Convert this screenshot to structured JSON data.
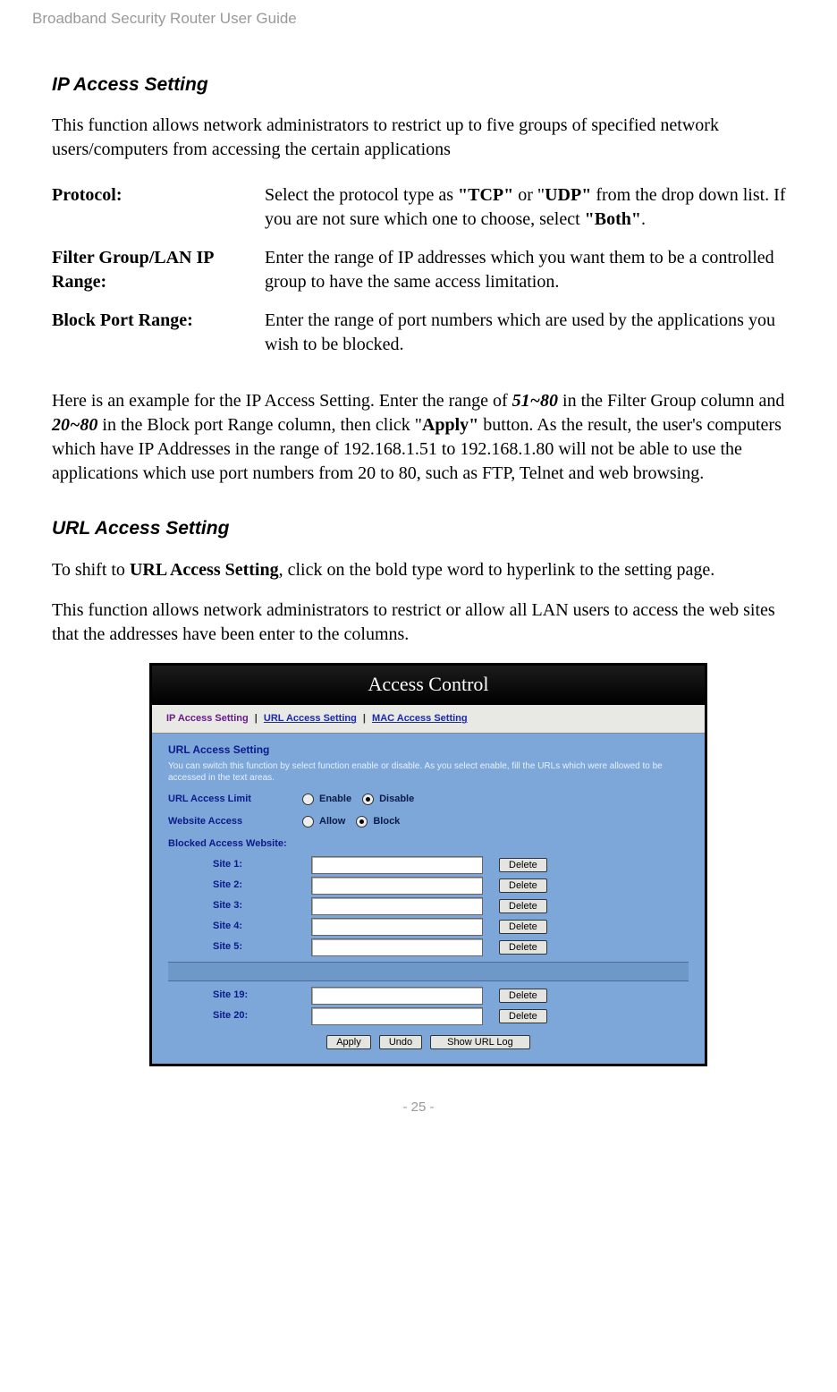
{
  "doc_header": "Broadband Security Router User Guide",
  "ip_section": {
    "heading": "IP Access Setting",
    "intro": "This function allows network administrators to restrict up to five groups of specified network users/computers from accessing the certain applications",
    "rows": [
      {
        "label": "Protocol:",
        "desc_pre": "Select the protocol type as ",
        "b1": "\"TCP\"",
        "mid1": " or \"",
        "b2": "UDP\"",
        "mid2": " from the drop down list. If you are not sure which one to choose, select ",
        "b3": "\"Both\"",
        "post": "."
      },
      {
        "label": "Filter Group/LAN IP Range:",
        "desc": "Enter the range of IP addresses which you want them to be a controlled group to have the same access limitation."
      },
      {
        "label": "Block Port Range:",
        "desc": "Enter the range of port numbers which are used by the applications you wish to be blocked."
      }
    ],
    "example_pre": "Here is an example for the IP Access Setting. Enter the range of ",
    "ex_b1": "51~80",
    "ex_mid1": " in the Filter Group column and ",
    "ex_b2": "20~80",
    "ex_mid2": " in the Block port Range column, then click \"",
    "ex_b3": "Apply\"",
    "ex_post": " button. As the result, the user's computers which have IP Addresses in the range of 192.168.1.51 to 192.168.1.80 will not be able to use the applications which use port numbers from 20 to 80, such as FTP, Telnet and web browsing."
  },
  "url_section": {
    "heading": "URL Access Setting",
    "p1_pre": "To shift to ",
    "p1_bold": "URL Access Setting",
    "p1_post": ", click on the bold type word to hyperlink to the setting page.",
    "p2": "This function allows network administrators to restrict or allow all LAN users to access the web sites that the addresses have been enter to the columns."
  },
  "ui": {
    "title": "Access Control",
    "nav": {
      "ip": "IP Access Setting",
      "url": "URL Access Setting",
      "mac": "MAC Access Setting",
      "sep": "|"
    },
    "panel_title": "URL Access Setting",
    "panel_desc": "You can switch this function by select function enable or disable. As you select enable, fill the URLs which were allowed to be accessed in the text areas.",
    "limit_label": "URL Access Limit",
    "enable": "Enable",
    "disable": "Disable",
    "access_label": "Website Access",
    "allow": "Allow",
    "block": "Block",
    "blocked_head": "Blocked Access Website:",
    "sites_top": [
      {
        "label": "Site 1:"
      },
      {
        "label": "Site 2:"
      },
      {
        "label": "Site 3:"
      },
      {
        "label": "Site 4:"
      },
      {
        "label": "Site 5:"
      }
    ],
    "sites_bottom": [
      {
        "label": "Site 19:"
      },
      {
        "label": "Site 20:"
      }
    ],
    "btn_delete": "Delete",
    "btn_apply": "Apply",
    "btn_undo": "Undo",
    "btn_showlog": "Show URL Log"
  },
  "page_footer": "- 25 -"
}
